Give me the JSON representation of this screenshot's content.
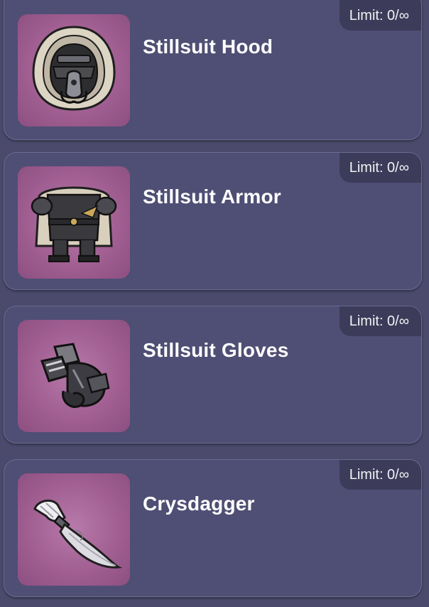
{
  "items": [
    {
      "name": "Stillsuit Hood",
      "limit": "Limit: 0/∞",
      "icon": "stillsuit-hood-icon"
    },
    {
      "name": "Stillsuit Armor",
      "limit": "Limit: 0/∞",
      "icon": "stillsuit-armor-icon"
    },
    {
      "name": "Stillsuit Gloves",
      "limit": "Limit: 0/∞",
      "icon": "stillsuit-gloves-icon"
    },
    {
      "name": "Crysdagger",
      "limit": "Limit: 0/∞",
      "icon": "crysdagger-icon"
    }
  ],
  "colors": {
    "card_bg": "#4f4e74",
    "card_border": "#6c6b92",
    "thumb_bg": "#a15f92",
    "limit_badge_bg": "#3c3b59"
  }
}
